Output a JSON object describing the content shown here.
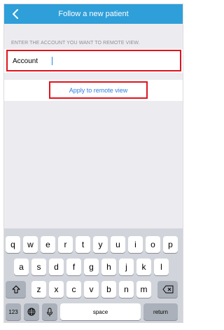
{
  "navbar": {
    "title": "Follow a new patient",
    "back_icon": "chevron-left-icon",
    "color": "#2f9fd9"
  },
  "form": {
    "section_label": "ENTER THE ACCOUNT YOU WANT TO REMOTE VIEW.",
    "account_label": "Account",
    "account_value": "",
    "apply_label": "Apply to remote view",
    "link_color": "#2f7fe0",
    "highlight_color": "#e0141e"
  },
  "keyboard": {
    "row1": [
      "q",
      "w",
      "e",
      "r",
      "t",
      "y",
      "u",
      "i",
      "o",
      "p"
    ],
    "row2": [
      "a",
      "s",
      "d",
      "f",
      "g",
      "h",
      "j",
      "k",
      "l"
    ],
    "row3": [
      "z",
      "x",
      "c",
      "v",
      "b",
      "n",
      "m"
    ],
    "shift_icon": "shift-icon",
    "delete_icon": "delete-icon",
    "numbers_label": "123",
    "globe_icon": "globe-icon",
    "mic_icon": "microphone-icon",
    "space_label": "space",
    "return_label": "return"
  }
}
